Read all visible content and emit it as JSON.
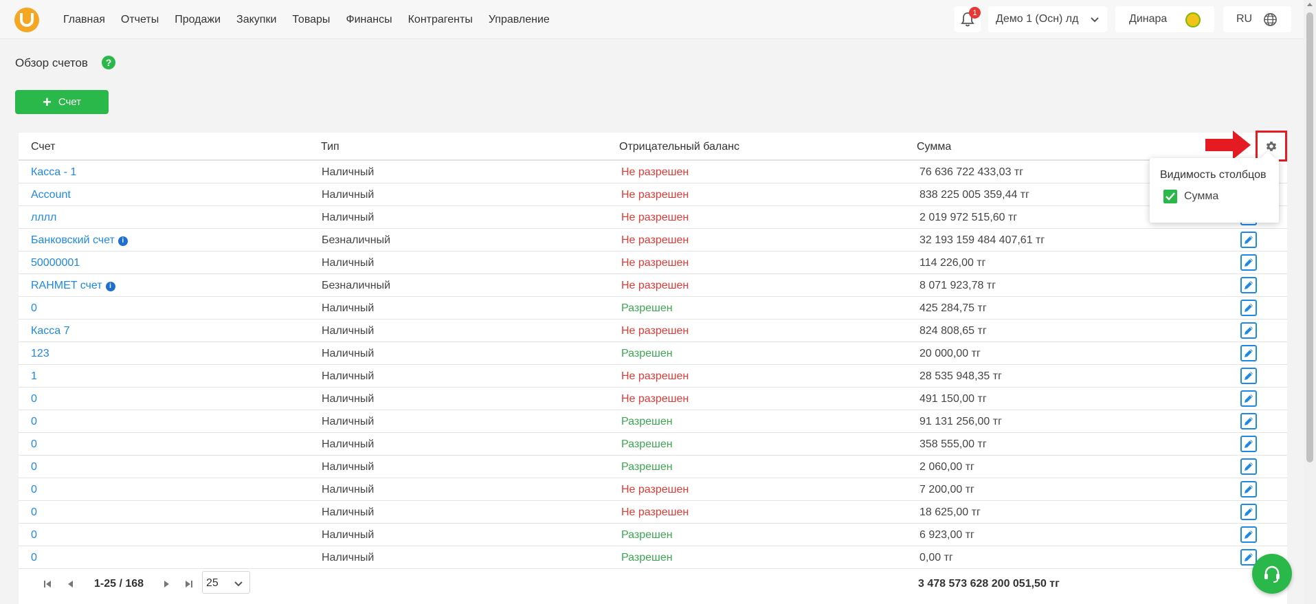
{
  "nav": {
    "items": [
      "Главная",
      "Отчеты",
      "Продажи",
      "Закупки",
      "Товары",
      "Финансы",
      "Контрагенты",
      "Управление"
    ]
  },
  "header": {
    "notification_count": "1",
    "company": "Демо 1 (Осн) лд",
    "user": "Динара",
    "lang": "RU"
  },
  "page": {
    "title": "Обзор счетов",
    "help": "?",
    "add_label": "Счет"
  },
  "table": {
    "columns": [
      "Счет",
      "Тип",
      "Отрицательный баланс",
      "Сумма"
    ],
    "rows": [
      {
        "account": "Касса - 1",
        "info": false,
        "type": "Наличный",
        "neg": "Не разрешен",
        "neg_allowed": false,
        "sum": "76 636 722 433,03 тг"
      },
      {
        "account": "Account",
        "info": false,
        "type": "Наличный",
        "neg": "Не разрешен",
        "neg_allowed": false,
        "sum": "838 225 005 359,44 тг"
      },
      {
        "account": "лллл",
        "info": false,
        "type": "Наличный",
        "neg": "Не разрешен",
        "neg_allowed": false,
        "sum": "2 019 972 515,60 тг"
      },
      {
        "account": "Банковский счет",
        "info": true,
        "type": "Безналичный",
        "neg": "Не разрешен",
        "neg_allowed": false,
        "sum": "32 193 159 484 407,61 тг"
      },
      {
        "account": "50000001",
        "info": false,
        "type": "Наличный",
        "neg": "Не разрешен",
        "neg_allowed": false,
        "sum": "114 226,00 тг"
      },
      {
        "account": "RAHMET счет",
        "info": true,
        "type": "Безналичный",
        "neg": "Не разрешен",
        "neg_allowed": false,
        "sum": "8 071 923,78 тг"
      },
      {
        "account": "0",
        "info": false,
        "type": "Наличный",
        "neg": "Разрешен",
        "neg_allowed": true,
        "sum": "425 284,75 тг"
      },
      {
        "account": "Касса 7",
        "info": false,
        "type": "Наличный",
        "neg": "Не разрешен",
        "neg_allowed": false,
        "sum": "824 808,65 тг"
      },
      {
        "account": "123",
        "info": false,
        "type": "Наличный",
        "neg": "Разрешен",
        "neg_allowed": true,
        "sum": "20 000,00 тг"
      },
      {
        "account": "1",
        "info": false,
        "type": "Наличный",
        "neg": "Не разрешен",
        "neg_allowed": false,
        "sum": "28 535 948,35 тг"
      },
      {
        "account": "0",
        "info": false,
        "type": "Наличный",
        "neg": "Не разрешен",
        "neg_allowed": false,
        "sum": "491 150,00 тг"
      },
      {
        "account": "0",
        "info": false,
        "type": "Наличный",
        "neg": "Разрешен",
        "neg_allowed": true,
        "sum": "91 131 256,00 тг"
      },
      {
        "account": "0",
        "info": false,
        "type": "Наличный",
        "neg": "Разрешен",
        "neg_allowed": true,
        "sum": "358 555,00 тг"
      },
      {
        "account": "0",
        "info": false,
        "type": "Наличный",
        "neg": "Разрешен",
        "neg_allowed": true,
        "sum": "2 060,00 тг"
      },
      {
        "account": "0",
        "info": false,
        "type": "Наличный",
        "neg": "Не разрешен",
        "neg_allowed": false,
        "sum": "7 200,00 тг"
      },
      {
        "account": "0",
        "info": false,
        "type": "Наличный",
        "neg": "Не разрешен",
        "neg_allowed": false,
        "sum": "18 625,00 тг"
      },
      {
        "account": "0",
        "info": false,
        "type": "Наличный",
        "neg": "Разрешен",
        "neg_allowed": true,
        "sum": "6 923,00 тг"
      },
      {
        "account": "0",
        "info": false,
        "type": "Наличный",
        "neg": "Разрешен",
        "neg_allowed": true,
        "sum": "0,00 тг"
      }
    ]
  },
  "column_visibility": {
    "title": "Видимость столбцов",
    "option_label": "Сумма",
    "option_checked": true
  },
  "pagination": {
    "range": "1-25 / 168",
    "page_size": "25",
    "total": "3 478 573 628 200 051,50 тг"
  },
  "colors": {
    "accent_green": "#2bb84a",
    "link_blue": "#1e88e5",
    "negative_red": "#e53935",
    "annotation_red": "#e41b23",
    "logo_orange": "#f5a623"
  },
  "icons": [
    "logo-icon",
    "help-icon",
    "plus-icon",
    "bell-icon",
    "chevron-down-icon",
    "avatar-icon",
    "globe-icon",
    "gear-icon",
    "info-icon",
    "edit-icon",
    "first-page-icon",
    "prev-page-icon",
    "next-page-icon",
    "last-page-icon",
    "headset-icon",
    "check-icon",
    "arrow-right-icon"
  ]
}
